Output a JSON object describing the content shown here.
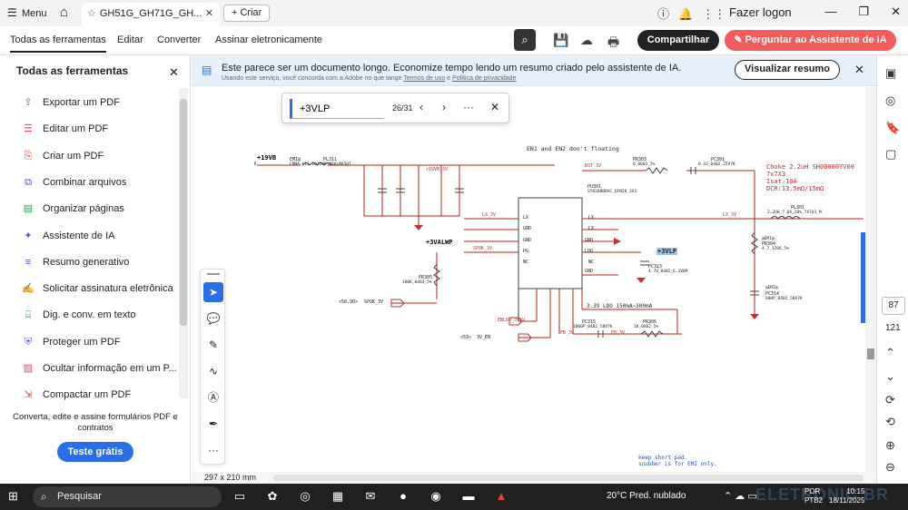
{
  "titlebar": {
    "menu_label": "Menu",
    "tab_title": "GH51G_GH71G_GH...",
    "new_tab_label": "Criar",
    "logon_label": "Fazer logon"
  },
  "menubar": {
    "items": [
      "Todas as ferramentas",
      "Editar",
      "Converter",
      "Assinar eletronicamente"
    ],
    "share_label": "Compartilhar",
    "ask_ai_label": "Perguntar ao Assistente de IA"
  },
  "leftpanel": {
    "title": "Todas as ferramentas",
    "items": [
      {
        "label": "Exportar um PDF",
        "icon": "export-icon",
        "color": "#2c8f9e"
      },
      {
        "label": "Editar um PDF",
        "icon": "edit-icon",
        "color": "#d9418a"
      },
      {
        "label": "Criar um PDF",
        "icon": "create-pdf-icon",
        "color": "#e0453b"
      },
      {
        "label": "Combinar arquivos",
        "icon": "combine-icon",
        "color": "#6a4fd1"
      },
      {
        "label": "Organizar páginas",
        "icon": "organize-icon",
        "color": "#2e9e4a"
      },
      {
        "label": "Assistente de IA",
        "icon": "ai-assistant-icon",
        "color": "#6a4fd1"
      },
      {
        "label": "Resumo generativo",
        "icon": "summary-icon",
        "color": "#6a4fd1"
      },
      {
        "label": "Solicitar assinatura eletrônica",
        "icon": "signature-icon",
        "color": "#7a3fc9"
      },
      {
        "label": "Dig. e conv. em texto",
        "icon": "scan-icon",
        "color": "#2e9e4a"
      },
      {
        "label": "Proteger um PDF",
        "icon": "protect-icon",
        "color": "#6a4fd1"
      },
      {
        "label": "Ocultar informação em um P...",
        "icon": "redact-icon",
        "color": "#d9418a"
      },
      {
        "label": "Compactar um PDF",
        "icon": "compress-icon",
        "color": "#e0453b"
      }
    ],
    "footer_text": "Converta, edite e assine formulários PDF e contratos",
    "trial_label": "Teste grátis"
  },
  "banner": {
    "message": "Este parece ser um documento longo. Economize tempo lendo um resumo criado pelo assistente de IA.",
    "subtext_before": "Usando este serviço, você concorda com a Adobe no que tange",
    "terms_link": "Termos de uso",
    "subtext_and": "e",
    "privacy_link": "Política de privacidade",
    "button_label": "Visualizar resumo"
  },
  "findbar": {
    "query": "+3VLP",
    "count": "26/31"
  },
  "status": {
    "page_size": "297 x 210 mm"
  },
  "rightrail": {
    "current_page": "87",
    "total_pages": "121"
  },
  "taskbar": {
    "search_placeholder": "Pesquisar",
    "weather": "20°C  Pred. nublado",
    "lang_line1": "POR",
    "lang_line2": "PTB2",
    "time": "10:15",
    "date": "18/11/2025",
    "watermark": "ELETRONIC BR"
  },
  "schematic": {
    "note_top": "EN1 and EN2 don't floating",
    "net_19vb": "+19VB",
    "net_3valwp": "+3VALWP",
    "net_3vlp": "+3VLP",
    "choke_spec_1": "Choke 2.2uH SH00000YV00",
    "choke_spec_2": "7x7X3",
    "choke_spec_3": "Isat:10A",
    "choke_spec_4": "DCR:13.5mΩ/15mΩ",
    "ic_ref": "PU301",
    "ic_part": "SY8288BRAC_QFN20_3X3",
    "ldo_note": "3.3V LDO 150mA~300mA",
    "bottom_note_1": "keep short pad.",
    "bottom_note_2": "snubber is for EMI only.",
    "sig_spok": "SPOK_3V",
    "sig_enldo": "ENLDO_3V5V",
    "sig_3ven": "3V_EN",
    "sig_lx": "LX_3V",
    "sig_bst": "BST_3V",
    "sig_fb": "FB_3V",
    "pl311": "PL311",
    "pl311_part": "FBMA-L11-201209-800LMA50T",
    "pl301": "PL301",
    "pl301_part": "2.2UH_7.6A_20%_7X7X3_M",
    "pr303": "PR303",
    "pr303_val": "0_0603_5%",
    "pc301": "PC301",
    "pc301_val": "0.1U_0402_25V7K",
    "pr305": "PR305",
    "pr305_val": "100K_0402_5%",
    "pc313": "PC313",
    "pc313_val": "4.7U_0402_6.3V6M",
    "pc315": "PC315",
    "pc315_val": "1000P_0402_50V7K",
    "pr306": "PR306",
    "pr306_val": "1K_0402_5%",
    "pr304": "PR304",
    "pr304_val": "4.7_1206_5%",
    "pc314": "PC314",
    "pc314_val": "680P_0402_50V7K",
    "ref_58": "<58,90>",
    "ref_59": "<59>"
  }
}
